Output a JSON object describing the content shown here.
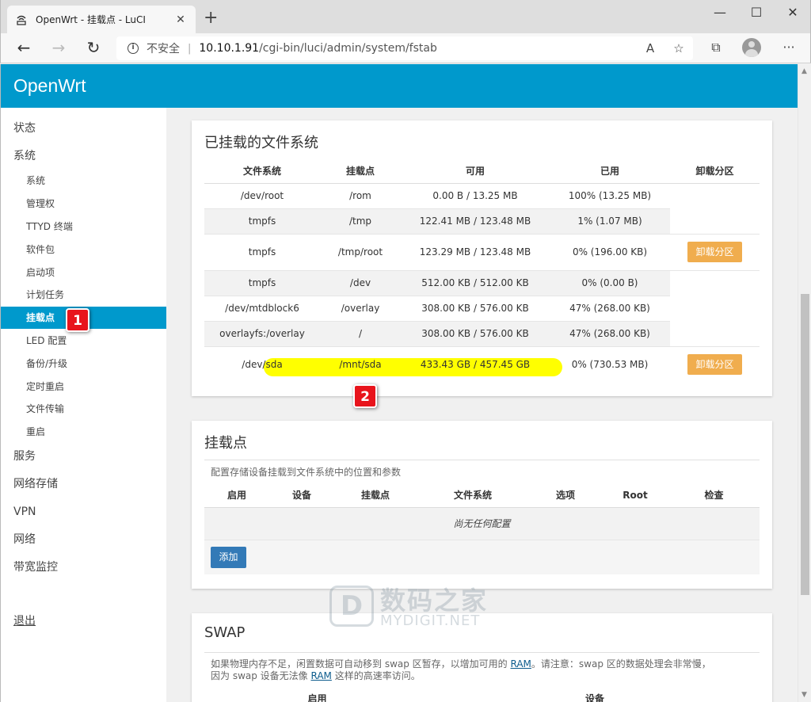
{
  "browser": {
    "tab_title": "OpenWrt - 挂载点 - LuCI",
    "tab_close": "✕",
    "new_tab": "+",
    "insecure_label": "不安全",
    "url_host": "10.10.1.91",
    "url_path": "/cgi-bin/luci/admin/system/fstab",
    "minimize": "—",
    "maximize": "☐",
    "close": "✕",
    "menu": "···"
  },
  "header": {
    "brand": "OpenWrt"
  },
  "sidebar": {
    "status": "状态",
    "system": "系统",
    "sub": [
      "系统",
      "管理权",
      "TTYD 终端",
      "软件包",
      "启动项",
      "计划任务",
      "挂载点",
      "LED 配置",
      "备份/升级",
      "定时重启",
      "文件传输",
      "重启"
    ],
    "services": "服务",
    "nas": "网络存储",
    "vpn": "VPN",
    "network": "网络",
    "bandwidth": "带宽监控",
    "logout": "退出"
  },
  "annotations": {
    "badge1": "1",
    "badge2": "2"
  },
  "mounted": {
    "title": "已挂载的文件系统",
    "headers": [
      "文件系统",
      "挂载点",
      "可用",
      "已用",
      "卸载分区"
    ],
    "rows": [
      [
        "/dev/root",
        "/rom",
        "0.00 B / 13.25 MB",
        "100% (13.25 MB)"
      ],
      [
        "tmpfs",
        "/tmp",
        "122.41 MB / 123.48 MB",
        "1% (1.07 MB)"
      ],
      [
        "tmpfs",
        "/tmp/root",
        "123.29 MB / 123.48 MB",
        "0% (196.00 KB)"
      ],
      [
        "tmpfs",
        "/dev",
        "512.00 KB / 512.00 KB",
        "0% (0.00 B)"
      ],
      [
        "/dev/mtdblock6",
        "/overlay",
        "308.00 KB / 576.00 KB",
        "47% (268.00 KB)"
      ],
      [
        "overlayfs:/overlay",
        "/",
        "308.00 KB / 576.00 KB",
        "47% (268.00 KB)"
      ],
      [
        "/dev/sda",
        "/mnt/sda",
        "433.43 GB / 457.45 GB",
        "0% (730.53 MB)"
      ]
    ],
    "unmount_label": "卸载分区"
  },
  "mountpoints": {
    "title": "挂载点",
    "desc": "配置存储设备挂载到文件系统中的位置和参数",
    "headers": [
      "启用",
      "设备",
      "挂载点",
      "文件系统",
      "选项",
      "Root",
      "检查"
    ],
    "empty": "尚无任何配置",
    "add_label": "添加"
  },
  "swap": {
    "title": "SWAP",
    "desc_a": "如果物理内存不足，闲置数据可自动移到 swap 区暂存，以增加可用的 ",
    "desc_link1": "RAM",
    "desc_b": "。请注意：swap 区的数据处理会非常慢，",
    "desc_c": "因为 swap 设备无法像 ",
    "desc_link2": "RAM",
    "desc_d": " 这样的高速率访问。",
    "headers": [
      "启用",
      "设备"
    ]
  },
  "watermark": {
    "cn": "数码之家",
    "en": "MYDIGIT.NET",
    "logo": "D"
  }
}
